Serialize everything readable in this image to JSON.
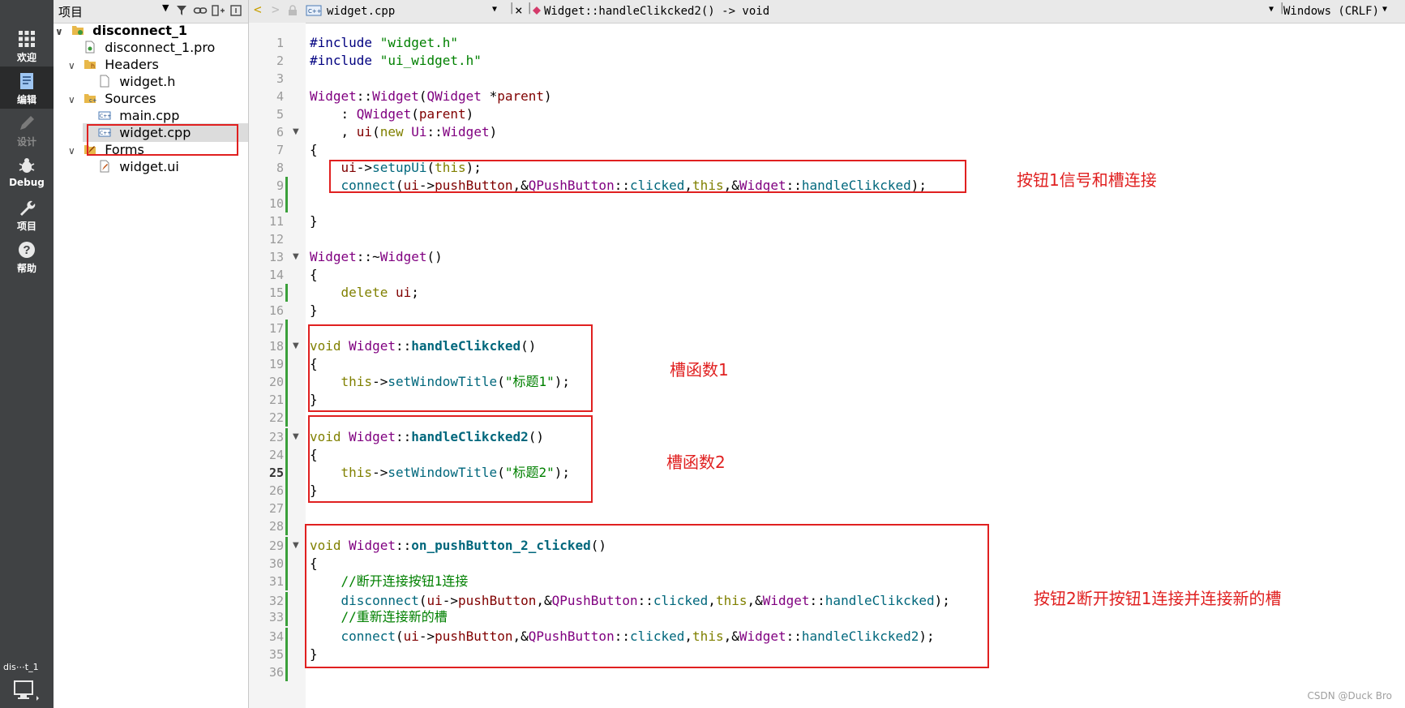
{
  "modes": [
    {
      "label": "欢迎",
      "icon": "grid-icon"
    },
    {
      "label": "编辑",
      "icon": "edit-document-icon"
    },
    {
      "label": "设计",
      "icon": "pencil-icon"
    },
    {
      "label": "Debug",
      "icon": "bug-icon"
    },
    {
      "label": "项目",
      "icon": "wrench-icon"
    },
    {
      "label": "帮助",
      "icon": "help-icon"
    }
  ],
  "kit_label": "dis⋯t_1",
  "project_pane": {
    "title": "项目",
    "tree": [
      {
        "label": "disconnect_1",
        "twisty": "∨",
        "icon": "folder-project-icon"
      },
      {
        "label": "disconnect_1.pro",
        "twisty": "",
        "icon": "pro-file-icon"
      },
      {
        "label": "Headers",
        "twisty": "∨",
        "icon": "folder-headers-icon"
      },
      {
        "label": "widget.h",
        "twisty": "",
        "icon": "header-file-icon"
      },
      {
        "label": "Sources",
        "twisty": "∨",
        "icon": "folder-sources-icon"
      },
      {
        "label": "main.cpp",
        "twisty": "",
        "icon": "cpp-file-icon"
      },
      {
        "label": "widget.cpp",
        "twisty": "",
        "icon": "cpp-file-icon"
      },
      {
        "label": "Forms",
        "twisty": "∨",
        "icon": "folder-forms-icon"
      },
      {
        "label": "widget.ui",
        "twisty": "",
        "icon": "ui-file-icon"
      }
    ]
  },
  "editor_toolbar": {
    "file_name": "widget.cpp",
    "function_name": "Widget::handleClikcked2() -> void",
    "line_ending": "Windows (CRLF)"
  },
  "code_lines": [
    {
      "n": "1",
      "text": "#include \"widget.h\""
    },
    {
      "n": "2",
      "text": "#include \"ui_widget.h\""
    },
    {
      "n": "3",
      "text": ""
    },
    {
      "n": "4",
      "text": "Widget::Widget(QWidget *parent)"
    },
    {
      "n": "5",
      "text": "    : QWidget(parent)"
    },
    {
      "n": "6",
      "text": "    , ui(new Ui::Widget)"
    },
    {
      "n": "7",
      "text": "{"
    },
    {
      "n": "8",
      "text": "    ui->setupUi(this);"
    },
    {
      "n": "9",
      "text": "    connect(ui->pushButton,&QPushButton::clicked,this,&Widget::handleClikcked);"
    },
    {
      "n": "10",
      "text": ""
    },
    {
      "n": "11",
      "text": "}"
    },
    {
      "n": "12",
      "text": ""
    },
    {
      "n": "13",
      "text": "Widget::~Widget()"
    },
    {
      "n": "14",
      "text": "{"
    },
    {
      "n": "15",
      "text": "    delete ui;"
    },
    {
      "n": "16",
      "text": "}"
    },
    {
      "n": "17",
      "text": ""
    },
    {
      "n": "18",
      "text": "void Widget::handleClikcked()"
    },
    {
      "n": "19",
      "text": "{"
    },
    {
      "n": "20",
      "text": "    this->setWindowTitle(\"标题1\");"
    },
    {
      "n": "21",
      "text": "}"
    },
    {
      "n": "22",
      "text": ""
    },
    {
      "n": "23",
      "text": "void Widget::handleClikcked2()"
    },
    {
      "n": "24",
      "text": "{"
    },
    {
      "n": "25",
      "text": "    this->setWindowTitle(\"标题2\");"
    },
    {
      "n": "26",
      "text": "}"
    },
    {
      "n": "27",
      "text": ""
    },
    {
      "n": "28",
      "text": ""
    },
    {
      "n": "29",
      "text": "void Widget::on_pushButton_2_clicked()"
    },
    {
      "n": "30",
      "text": "{"
    },
    {
      "n": "31",
      "text": "    //断开连接按钮1连接"
    },
    {
      "n": "32",
      "text": "    disconnect(ui->pushButton,&QPushButton::clicked,this,&Widget::handleClikcked);"
    },
    {
      "n": "33",
      "text": "    //重新连接新的槽"
    },
    {
      "n": "34",
      "text": "    connect(ui->pushButton,&QPushButton::clicked,this,&Widget::handleClikcked2);"
    },
    {
      "n": "35",
      "text": "}"
    },
    {
      "n": "36",
      "text": ""
    }
  ],
  "annotations": {
    "connect_note": "按钮1信号和槽连接",
    "slot1_note": "槽函数1",
    "slot2_note": "槽函数2",
    "disconnect_note": "按钮2断开按钮1连接并连接新的槽"
  },
  "watermark": "CSDN @Duck Bro",
  "colors": {
    "annotation_red": "#e02020",
    "keyword": "#808000",
    "type": "#800080",
    "function": "#00677c",
    "string": "#008000",
    "comment": "#008000"
  }
}
